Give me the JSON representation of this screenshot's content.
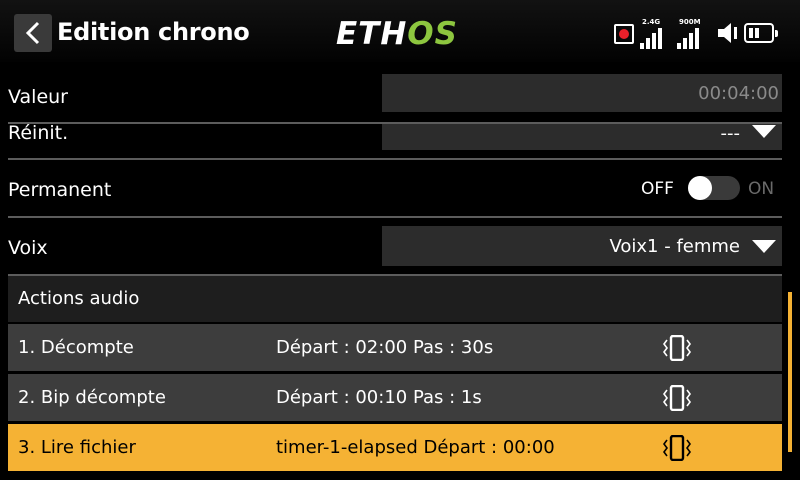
{
  "header": {
    "title": "Edition chrono",
    "logo_white": "ETH",
    "logo_green": "OS",
    "signal_1_label": "2.4G",
    "signal_2_label": "900M"
  },
  "form": {
    "valeur": {
      "label": "Valeur",
      "value": "00:04:00"
    },
    "reinit": {
      "label": "Réinit.",
      "value": "---"
    },
    "permanent": {
      "label": "Permanent",
      "off": "OFF",
      "on": "ON",
      "state": "off"
    },
    "voix": {
      "label": "Voix",
      "value": "Voix1 - femme"
    }
  },
  "audio": {
    "title": "Actions audio",
    "items": [
      {
        "name": "1. Décompte",
        "info": "Départ : 02:00 Pas : 30s"
      },
      {
        "name": "2. Bip décompte",
        "info": "Départ : 00:10 Pas : 1s"
      },
      {
        "name": "3. Lire fichier",
        "info": "timer-1-elapsed Départ : 00:00",
        "selected": true
      }
    ]
  },
  "colors": {
    "accent": "#f5b234",
    "logo_green": "#8dc63f",
    "record_red": "#e8202a"
  },
  "icons": [
    "back-icon",
    "record-icon",
    "signal-icon",
    "speaker-icon",
    "battery-icon",
    "dropdown-icon",
    "vibrate-icon"
  ]
}
